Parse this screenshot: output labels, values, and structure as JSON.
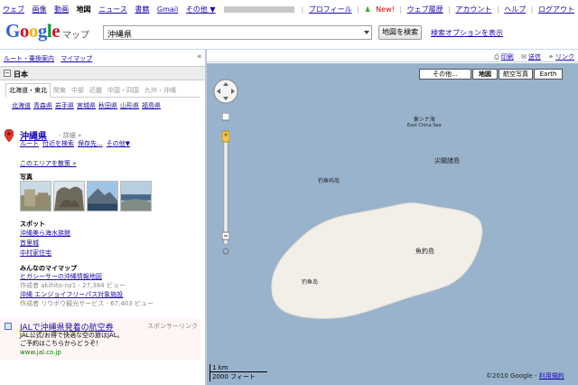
{
  "topbar": {
    "left": [
      "ウェブ",
      "画像",
      "動画",
      "地図",
      "ニュース",
      "書籍",
      "Gmail",
      "その他 ▼"
    ],
    "selected_index": 3,
    "right": {
      "separator": "|",
      "profile": "プロフィール",
      "new_label": "New!",
      "history": "ウェブ履歴",
      "account": "アカウント",
      "help": "ヘルプ",
      "logout": "ログアウト"
    }
  },
  "logo": "Google",
  "product_label": "マップ",
  "search": {
    "value": "沖縄県",
    "button": "地図を検索",
    "options_link": "検索オプションを表示"
  },
  "left_links": {
    "directions": "ルート・乗換案内",
    "mymaps": "マイマップ"
  },
  "collapse_icon": "«",
  "section_title": "日本",
  "section_toggle": "−",
  "regions": [
    "北海道・東北",
    "関東",
    "中部",
    "近畿",
    "中国・四国",
    "九州・沖縄"
  ],
  "active_region_index": 0,
  "prefectures": [
    "北海道",
    "青森県",
    "岩手県",
    "宮城県",
    "秋田県",
    "山形県",
    "福島県"
  ],
  "result": {
    "title": "沖縄県",
    "detail": "- 詳細 »",
    "actions": [
      "ルート",
      "付近を検索",
      "保存先...",
      "その他▼"
    ],
    "explore": "このエリアを散策 »",
    "photos_heading": "写真",
    "spots_heading": "スポット",
    "spots": [
      "沖縄美ら海水族館",
      "首里城",
      "中村家住宅"
    ],
    "mymaps_heading": "みんなのマイマップ",
    "mymaps": [
      {
        "title": "ヒガシーサーの沖縄情報地図",
        "meta": "作成者 akihito-nz1 - 27,384 ビュー"
      },
      {
        "title": "沖縄 エンジョイフリーパス対象施設",
        "meta": "作成者 リウボウ観光サービス - 67,403 ビュー"
      }
    ]
  },
  "ad": {
    "title": "JALで沖縄県発着の航空券",
    "sponsor": "スポンサーリンク",
    "line1": "JAL公式/お得で快適な空の旅はJAL。",
    "line2": "ご予約はこちらからどうぞ！",
    "url": "www.jal.co.jp"
  },
  "map_actions": {
    "print": "印刷",
    "send": "送信",
    "link": "リンク"
  },
  "map_types": [
    "その他...",
    "地図",
    "航空写真",
    "Earth"
  ],
  "active_map_type_index": 1,
  "map_labels": {
    "east_china_sea_ja": "東シナ海",
    "east_china_sea_en": "East China Sea",
    "senkaku": "尖閣諸島",
    "kuba": "钓鱼屿岛",
    "uotsuri": "魚釣島",
    "kita": "钓鱼岛"
  },
  "scale": {
    "km": "1 km",
    "ft": "2000 フィート"
  },
  "copyright": {
    "text": "©2010 Google - ",
    "link": "利用規約"
  },
  "colors": {
    "water": "#99b3cc",
    "land": "#f2efe9",
    "link": "#1a0dab"
  }
}
